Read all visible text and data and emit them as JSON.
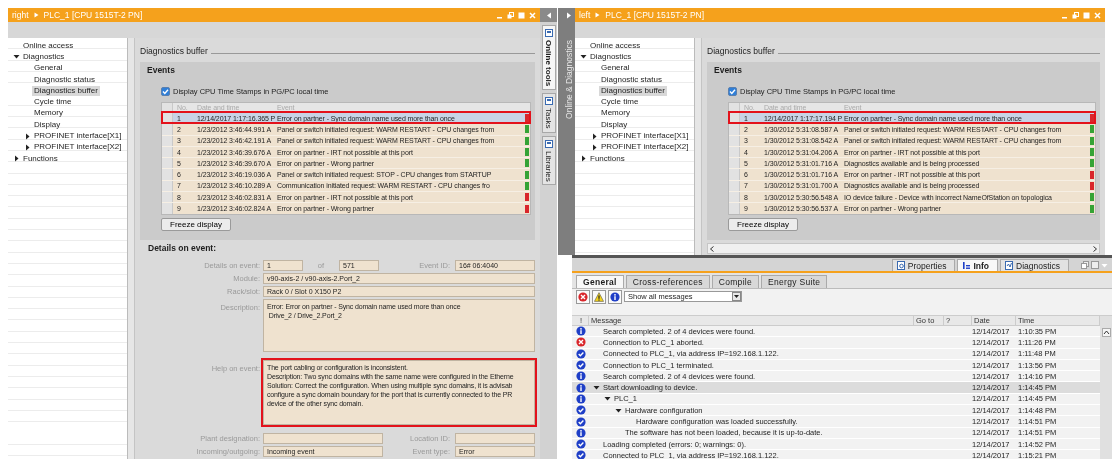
{
  "editors": [
    {
      "breadcrumb": [
        "right",
        "PLC_1 [CPU 1515T-2 PN]"
      ],
      "nav": [
        {
          "label": "Online access",
          "selected": false
        },
        {
          "label": "Diagnostics",
          "selected": false,
          "expanded": true,
          "children": [
            {
              "label": "General",
              "selected": false
            },
            {
              "label": "Diagnostic status",
              "selected": false
            },
            {
              "label": "Diagnostics buffer",
              "selected": true
            },
            {
              "label": "Cycle time",
              "selected": false
            },
            {
              "label": "Memory",
              "selected": false
            },
            {
              "label": "Display",
              "selected": false
            },
            {
              "label": "PROFINET interface[X1]",
              "selected": false,
              "expanded": false
            },
            {
              "label": "PROFINET interface[X2]",
              "selected": false,
              "expanded": false
            }
          ]
        },
        {
          "label": "Functions",
          "selected": false,
          "expanded": false
        }
      ],
      "section_title": "Diagnostics buffer",
      "events": {
        "title": "Events",
        "checkbox": {
          "label": "Display CPU Time Stamps in PG/PC local time",
          "checked": true
        },
        "columns": [
          "No.",
          "Date and time",
          "Event"
        ],
        "rows": [
          {
            "no": "1",
            "date": "12/14/2017 1:17:16.365 P",
            "event": "Error on partner - Sync domain name used more than once",
            "color": "#d9262b",
            "selected": true,
            "highlighted": true
          },
          {
            "no": "2",
            "date": "1/23/2012 3:46:44.991 A",
            "event": "Panel or switch initiated request: WARM RESTART - CPU changes from",
            "color": "#35a335",
            "selected": false,
            "highlighted": false
          },
          {
            "no": "3",
            "date": "1/23/2012 3:46:42.191 A",
            "event": "Panel or switch initiated request: WARM RESTART - CPU changes from",
            "color": "#35a335",
            "selected": false,
            "highlighted": false
          },
          {
            "no": "4",
            "date": "1/23/2012 3:46:39.676 A",
            "event": "Error on partner - IRT not possible at this port",
            "color": "#35a335",
            "selected": false,
            "highlighted": false
          },
          {
            "no": "5",
            "date": "1/23/2012 3:46:39.670 A",
            "event": "Error on partner - Wrong partner",
            "color": "#35a335",
            "selected": false,
            "highlighted": false
          },
          {
            "no": "6",
            "date": "1/23/2012 3:46:19.036 A",
            "event": "Panel or switch initiated request: STOP - CPU changes from STARTUP",
            "color": "#35a335",
            "selected": false,
            "highlighted": false
          },
          {
            "no": "7",
            "date": "1/23/2012 3:46:10.289 A",
            "event": "Communication initiated request: WARM RESTART - CPU changes fro",
            "color": "#35a335",
            "selected": false,
            "highlighted": false
          },
          {
            "no": "8",
            "date": "1/23/2012 3:46:02.831 A",
            "event": "Error on partner - IRT not possible at this port",
            "color": "#d9262b",
            "selected": false,
            "highlighted": false
          },
          {
            "no": "9",
            "date": "1/23/2012 3:46:02.824 A",
            "event": "Error on partner - Wrong partner",
            "color": "#d9262b",
            "selected": false,
            "highlighted": false
          }
        ],
        "button": "Freeze display"
      },
      "details": {
        "title": "Details on event:",
        "fields": [
          {
            "kind": "index",
            "label": "Details on event:",
            "value": "1",
            "of": "of",
            "total": "571",
            "id_label": "Event ID:",
            "id_value": "16# 06:4040"
          },
          {
            "kind": "single",
            "label": "Module:",
            "value": "v90-axis-2 / v90-axis-2.Port_2"
          },
          {
            "kind": "single",
            "label": "Rack/slot:",
            "value": "Rack 0 / Slot 0 X150 P2"
          },
          {
            "kind": "multiline",
            "label": "Description:",
            "lines": [
              "Error: Error on partner - Sync domain name used more than once",
              " Drive_2 / Drive_2.Port_2"
            ],
            "highlighted": false
          },
          {
            "kind": "multiline",
            "label": "Help on event:",
            "lines": [
              "The port cabling or configuration is inconsistent.",
              "Description: Two sync domains with the same name were configured in the Etherne",
              "Solution: Correct the configuration. When using multiple sync domains, it is advisab",
              "configure a sync domain boundary for the port that is currently connected to the PR",
              "device of the other sync domain."
            ],
            "highlighted": true
          },
          {
            "kind": "pair",
            "label": "Plant designation:",
            "label2": "Location ID:"
          },
          {
            "kind": "pair",
            "label": "Incoming/outgoing:",
            "value": "Incoming event",
            "label2": "Event type:",
            "value2": "Error"
          }
        ]
      }
    },
    {
      "breadcrumb": [
        "left",
        "PLC_1 [CPU 1515T-2 PN]"
      ],
      "nav": [
        {
          "label": "Online access",
          "selected": false
        },
        {
          "label": "Diagnostics",
          "selected": false,
          "expanded": true,
          "children": [
            {
              "label": "General",
              "selected": false
            },
            {
              "label": "Diagnostic status",
              "selected": false
            },
            {
              "label": "Diagnostics buffer",
              "selected": true
            },
            {
              "label": "Cycle time",
              "selected": false
            },
            {
              "label": "Memory",
              "selected": false
            },
            {
              "label": "Display",
              "selected": false
            },
            {
              "label": "PROFINET interface[X1]",
              "selected": false,
              "expanded": false
            },
            {
              "label": "PROFINET interface[X2]",
              "selected": false,
              "expanded": false
            }
          ]
        },
        {
          "label": "Functions",
          "selected": false,
          "expanded": false
        }
      ],
      "section_title": "Diagnostics buffer",
      "events": {
        "title": "Events",
        "checkbox": {
          "label": "Display CPU Time Stamps in PG/PC local time",
          "checked": true
        },
        "columns": [
          "No.",
          "Date and time",
          "Event"
        ],
        "rows": [
          {
            "no": "1",
            "date": "12/14/2017 1:17:17.194 P",
            "event": "Error on partner - Sync domain name used more than once",
            "color": "#d9262b",
            "selected": true,
            "highlighted": true
          },
          {
            "no": "2",
            "date": "1/30/2012 5:31:08.587 A",
            "event": "Panel or switch initiated request: WARM RESTART - CPU changes from",
            "color": "#35a335",
            "selected": false,
            "highlighted": false
          },
          {
            "no": "3",
            "date": "1/30/2012 5:31:08.542 A",
            "event": "Panel or switch initiated request: WARM RESTART - CPU changes from",
            "color": "#35a335",
            "selected": false,
            "highlighted": false
          },
          {
            "no": "4",
            "date": "1/30/2012 5:31:04.206 A",
            "event": "Error on partner - IRT not possible at this port",
            "color": "#35a335",
            "selected": false,
            "highlighted": false
          },
          {
            "no": "5",
            "date": "1/30/2012 5:31:01.716 A",
            "event": "Diagnostics available and is being processed",
            "color": "#35a335",
            "selected": false,
            "highlighted": false
          },
          {
            "no": "6",
            "date": "1/30/2012 5:31:01.716 A",
            "event": "Error on partner - IRT not possible at this port",
            "color": "#d9262b",
            "selected": false,
            "highlighted": false
          },
          {
            "no": "7",
            "date": "1/30/2012 5:31:01.700 A",
            "event": "Diagnostics available and is being processed",
            "color": "#d9262b",
            "selected": false,
            "highlighted": false
          },
          {
            "no": "8",
            "date": "1/30/2012 5:30:56.548 A",
            "event": "IO device failure - Device with incorrect NameOfStation on topologica",
            "color": "#35a335",
            "selected": false,
            "highlighted": false
          },
          {
            "no": "9",
            "date": "1/30/2012 5:30:56.537 A",
            "event": "Error on partner - Wrong partner",
            "color": "#35a335",
            "selected": false,
            "highlighted": false
          }
        ],
        "button": "Freeze display"
      }
    }
  ],
  "task_tabs": [
    {
      "label": "Online tools",
      "selected": true
    },
    {
      "label": "Tasks",
      "selected": false
    },
    {
      "label": "Libraries",
      "selected": false
    }
  ],
  "side_panel": {
    "label": "Online & Diagnostics"
  },
  "inspector": {
    "tabs": [
      {
        "label": "Properties",
        "kind": "properties",
        "selected": false
      },
      {
        "label": "Info",
        "kind": "info",
        "selected": true
      },
      {
        "label": "Diagnostics",
        "kind": "diagnostics",
        "selected": false
      }
    ],
    "subtabs": [
      {
        "label": "General",
        "selected": true
      },
      {
        "label": "Cross-references",
        "selected": false
      },
      {
        "label": "Compile",
        "selected": false
      },
      {
        "label": "Energy Suite",
        "selected": false
      }
    ],
    "filter": {
      "value": "Show all messages"
    },
    "columns": [
      "!",
      "Message",
      "Go to",
      "?",
      "Date",
      "Time"
    ],
    "messages": [
      {
        "kind": "info",
        "text": "Search completed. 2 of 4 devices were found.",
        "date": "12/14/2017",
        "time": "1:10:35 PM",
        "selected": false
      },
      {
        "kind": "error",
        "text": "Connection to PLC_1 aborted.",
        "date": "12/14/2017",
        "time": "1:11:26 PM",
        "selected": false
      },
      {
        "kind": "success",
        "text": "Connected to PLC_1, via address IP=192.168.1.122.",
        "date": "12/14/2017",
        "time": "1:11:48 PM",
        "selected": false
      },
      {
        "kind": "success",
        "text": "Connection to PLC_1 terminated.",
        "date": "12/14/2017",
        "time": "1:13:56 PM",
        "selected": false
      },
      {
        "kind": "info",
        "text": "Search completed. 2 of 4 devices were found.",
        "date": "12/14/2017",
        "time": "1:14:16 PM",
        "selected": false
      },
      {
        "kind": "info",
        "text": "Start downloading to device.",
        "date": "12/14/2017",
        "time": "1:14:45 PM",
        "selected": true,
        "expanded": true,
        "children": [
          {
            "kind": "info",
            "text": "PLC_1",
            "date": "12/14/2017",
            "time": "1:14:45 PM",
            "selected": false,
            "expanded": true,
            "children": [
              {
                "kind": "success",
                "text": "Hardware configuration",
                "date": "12/14/2017",
                "time": "1:14:48 PM",
                "selected": false,
                "expanded": true,
                "children": [
                  {
                    "kind": "success",
                    "text": "Hardware configuration was loaded successfully.",
                    "date": "12/14/2017",
                    "time": "1:14:51 PM",
                    "selected": false
                  }
                ]
              },
              {
                "kind": "info",
                "text": "The software has not been loaded, because it is up-to-date.",
                "date": "12/14/2017",
                "time": "1:14:51 PM",
                "selected": false
              }
            ]
          }
        ]
      },
      {
        "kind": "success",
        "text": "Loading completed (errors: 0; warnings: 0).",
        "date": "12/14/2017",
        "time": "1:14:52 PM",
        "selected": false
      },
      {
        "kind": "success",
        "text": "Connected to PLC_1, via address IP=192.168.1.122.",
        "date": "12/14/2017",
        "time": "1:15:21 PM",
        "selected": false
      }
    ]
  }
}
